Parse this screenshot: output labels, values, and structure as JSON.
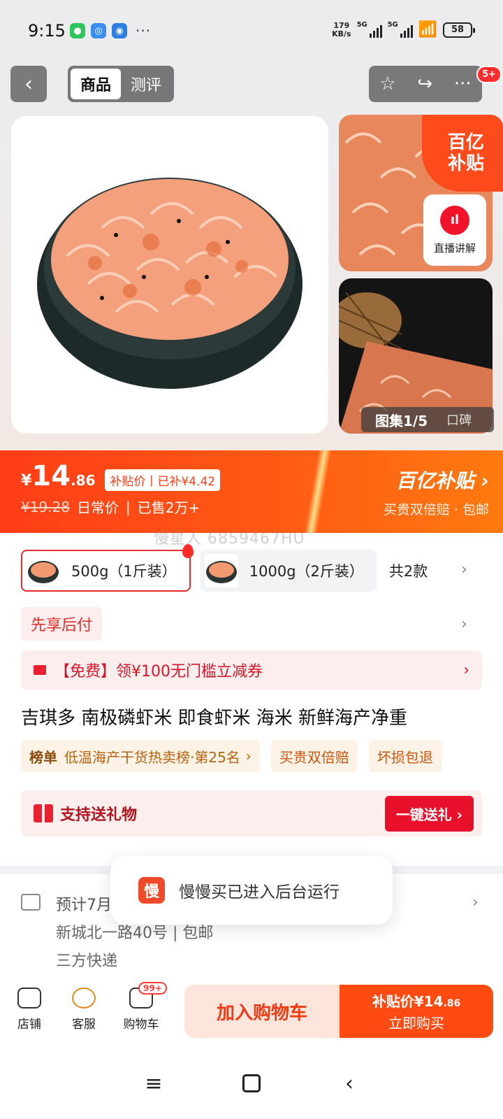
{
  "status_bar": {
    "time": "9:15",
    "speed_value": "179",
    "speed_unit": "KB/s",
    "net1": "5G",
    "net2": "5G",
    "wifi_level": "6",
    "battery": "58"
  },
  "header": {
    "tabs": [
      {
        "label": "商品"
      },
      {
        "label": "测评"
      }
    ],
    "more_badge": "5+"
  },
  "gallery": {
    "subsidy_corner_line1": "百亿",
    "subsidy_corner_line2": "补贴",
    "live_label": "直播讲解",
    "counter": "图集1/5",
    "review_tab": "口碑"
  },
  "price": {
    "currency": "¥",
    "integer": "14",
    "decimal": ".86",
    "subsidy_tag": "补贴价丨已补¥4.42",
    "original": "¥19.28",
    "original_label": "日常价",
    "sold": "已售2万+",
    "brand": "百亿补贴",
    "brand_sub": "买贵双倍赔 · 包邮"
  },
  "watermark": "慢星人 6859467HU",
  "skus": {
    "options": [
      {
        "label": "500g（1斤装）",
        "selected": true
      },
      {
        "label": "1000g（2斤装）",
        "selected": false
      }
    ],
    "count_label": "共2款"
  },
  "paylater": "先享后付",
  "coupon": "【免费】领¥100无门槛立减券",
  "product_title": "吉琪多 南极磷虾米 即食虾米 海米 新鲜海产净重",
  "tags": {
    "rank_prefix": "榜单",
    "rank_text": "低温海产干货热卖榜·第25名",
    "services": [
      "买贵双倍赔",
      "坏损包退"
    ]
  },
  "gift": {
    "label": "支持送礼物",
    "button": "一键送礼"
  },
  "shipping": {
    "line1": "预计7月",
    "line2": "新城北一路40号 | 包邮",
    "line3": "三方快递"
  },
  "toast": {
    "icon_char": "慢",
    "text": "慢慢买已进入后台运行"
  },
  "bottom_bar": {
    "store": "店铺",
    "service": "客服",
    "cart": "购物车",
    "cart_badge": "99+",
    "add_to_cart": "加入购物车",
    "buy_price_label": "补贴价¥14",
    "buy_price_decimal": ".86",
    "buy_now": "立即购买"
  },
  "colors": {
    "accent": "#ff4a12",
    "red": "#e8102a",
    "subsidy_orange": "#ff5a14"
  }
}
